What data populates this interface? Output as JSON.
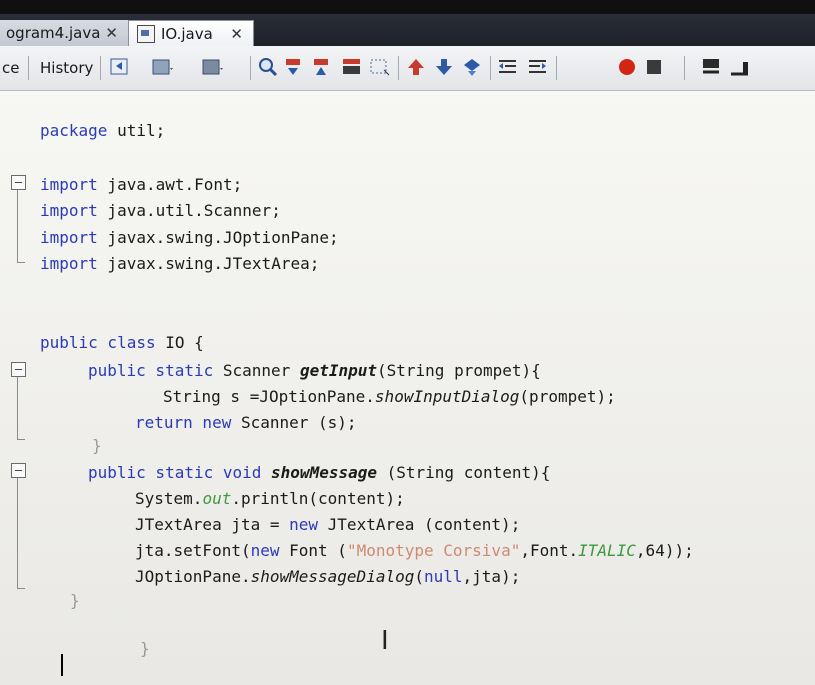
{
  "tabs": [
    {
      "label": "ogram4.java",
      "close": "✕",
      "active": false
    },
    {
      "label": "IO.java",
      "close": "✕",
      "active": true
    }
  ],
  "toolbar": {
    "source_label": "ce",
    "history_label": "History",
    "icons": [
      "back-icon",
      "history-list-icon",
      "forward-icon",
      "find-icon",
      "find-previous-icon",
      "find-next-icon",
      "toggle-highlight-icon",
      "toggle-rectangular-selection-icon",
      "previous-bookmark-icon",
      "next-bookmark-icon",
      "toggle-bookmark-icon",
      "shift-left-icon",
      "shift-right-icon",
      "start-macro-recording-icon",
      "stop-macro-recording-icon",
      "comment-icon",
      "uncomment-icon"
    ]
  },
  "editor": {
    "lines": {
      "l1_kw": "package",
      "l1_rest": " util;",
      "l2_kw": "import",
      "l2_rest": " java.awt.Font;",
      "l3_kw": "import",
      "l3_rest": " java.util.Scanner;",
      "l4_kw": "import",
      "l4_rest": " javax.swing.JOptionPane;",
      "l5_kw": "import",
      "l5_rest": " javax.swing.JTextArea;",
      "l6_kw": "public class",
      "l6_rest": " IO {",
      "l7_kw": "public static",
      "l7_a": " Scanner ",
      "l7_m": "getInput",
      "l7_b": "(String prompet){",
      "l8_a": "String s =JOptionPane.",
      "l8_m": "showInputDialog",
      "l8_b": "(prompet);",
      "l9_kw": "return new",
      "l9_rest": " Scanner (s);",
      "l10": "}",
      "l11_kw": "public static void",
      "l11_sp": " ",
      "l11_m": "showMessage",
      "l11_b": " (String content){",
      "l12_a": "System.",
      "l12_f": "out",
      "l12_b": ".println(content);",
      "l13_a": "JTextArea jta = ",
      "l13_kw": "new",
      "l13_b": " JTextArea (content);",
      "l14_a": "jta.setFont(",
      "l14_kw": "new",
      "l14_b": " Font (",
      "l14_s": "\"Monotype Corsiva\"",
      "l14_c": ",Font.",
      "l14_f": "ITALIC",
      "l14_d": ",64));",
      "l15_a": "JOptionPane.",
      "l15_m": "showMessageDialog",
      "l15_b": "(",
      "l15_kw": "null",
      "l15_c": ",jta);",
      "l16": "}",
      "l17": "}"
    }
  }
}
